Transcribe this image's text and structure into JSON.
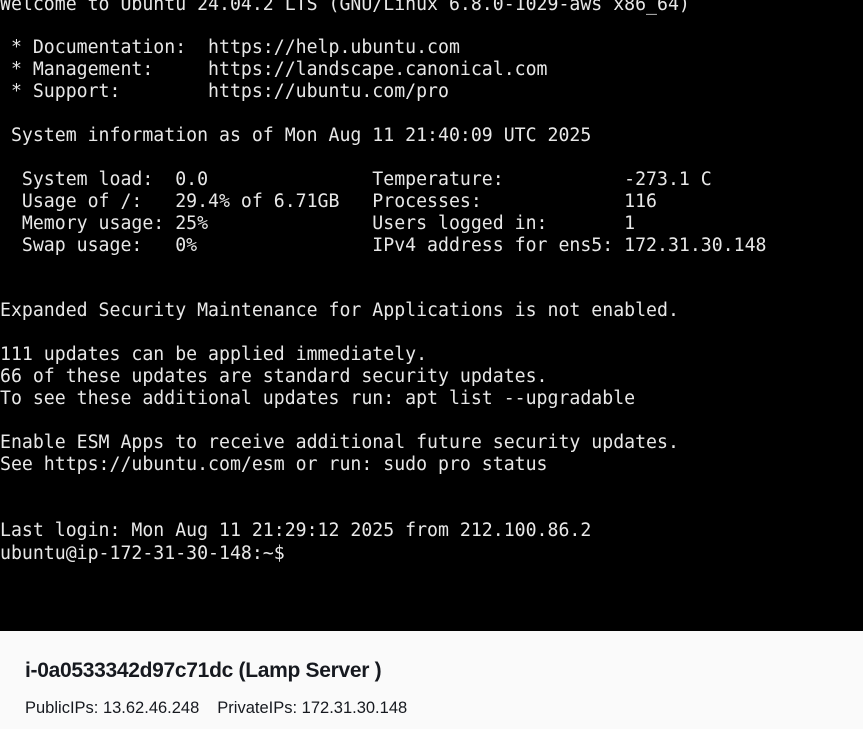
{
  "terminal": {
    "welcome": "Welcome to Ubuntu 24.04.2 LTS (GNU/Linux 6.8.0-1029-aws x86_64)",
    "links": [
      " * Documentation:  https://help.ubuntu.com",
      " * Management:     https://landscape.canonical.com",
      " * Support:        https://ubuntu.com/pro"
    ],
    "sysinfo_header": " System information as of Mon Aug 11 21:40:09 UTC 2025",
    "sysinfo_rows": [
      "  System load:  0.0               Temperature:           -273.1 C",
      "  Usage of /:   29.4% of 6.71GB   Processes:             116",
      "  Memory usage: 25%               Users logged in:       1",
      "  Swap usage:   0%                IPv4 address for ens5: 172.31.30.148"
    ],
    "esm_notice": "Expanded Security Maintenance for Applications is not enabled.",
    "updates": [
      "111 updates can be applied immediately.",
      "66 of these updates are standard security updates.",
      "To see these additional updates run: apt list --upgradable"
    ],
    "esm_apps": [
      "Enable ESM Apps to receive additional future security updates.",
      "See https://ubuntu.com/esm or run: sudo pro status"
    ],
    "last_login": "Last login: Mon Aug 11 21:29:12 2025 from 212.100.86.2",
    "prompt": "ubuntu@ip-172-31-30-148:~$"
  },
  "instance": {
    "title": "i-0a0533342d97c71dc (Lamp Server )",
    "public_ips": "PublicIPs: 13.62.46.248",
    "private_ips": "PrivateIPs: 172.31.30.148"
  }
}
